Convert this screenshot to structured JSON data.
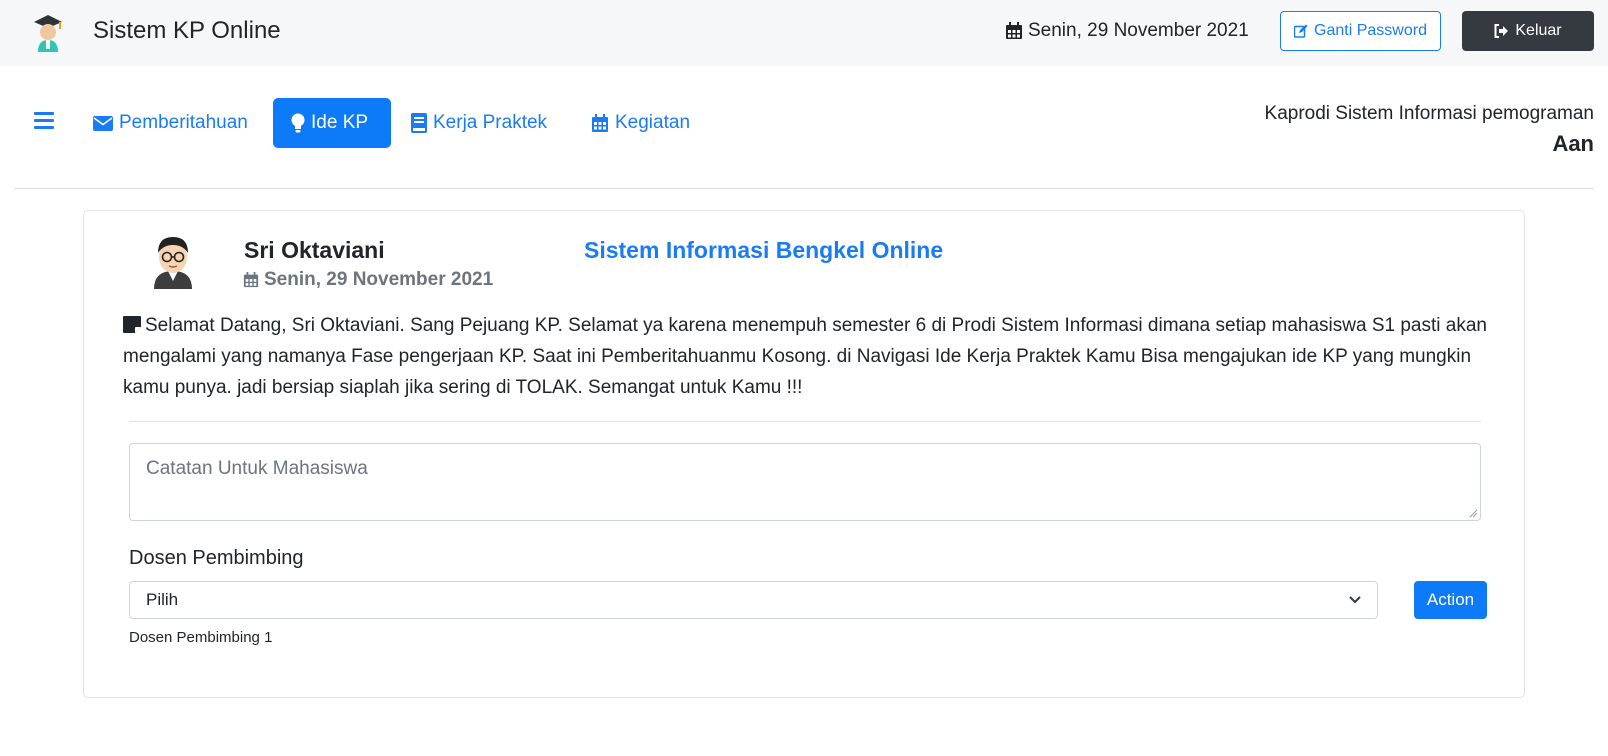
{
  "header": {
    "app_title": "Sistem KP Online",
    "date": "Senin, 29 November 2021",
    "change_password_label": "Ganti Password",
    "logout_label": "Keluar",
    "logo_icon": "graduate-icon"
  },
  "nav": {
    "items": [
      {
        "label": "Pemberitahuan",
        "icon": "envelope-icon",
        "active": false
      },
      {
        "label": "Ide KP",
        "icon": "lightbulb-icon",
        "active": true
      },
      {
        "label": "Kerja Praktek",
        "icon": "book-icon",
        "active": false
      },
      {
        "label": "Kegiatan",
        "icon": "calendar-icon",
        "active": false
      }
    ],
    "menu_icon": "hamburger-icon"
  },
  "user": {
    "role": "Kaprodi Sistem Informasi pemograman",
    "name": "Aan"
  },
  "card": {
    "student_name": "Sri Oktaviani",
    "date": "Senin, 29 November 2021",
    "project_title": "Sistem Informasi Bengkel Online",
    "message": "Selamat Datang, Sri Oktaviani. Sang Pejuang KP. Selamat ya karena menempuh semester 6 di Prodi Sistem Informasi dimana setiap mahasiswa S1 pasti akan mengalami yang namanya Fase pengerjaan KP. Saat ini Pemberitahuanmu Kosong. di Navigasi Ide Kerja Praktek Kamu Bisa mengajukan ide KP yang mungkin kamu punya. jadi bersiap siaplah jika sering di TOLAK. Semangat untuk Kamu !!!",
    "note_placeholder": "Catatan Untuk Mahasiswa",
    "supervisor_label": "Dosen Pembimbing",
    "supervisor_selected": "Pilih",
    "action_label": "Action",
    "supervisor_help": "Dosen Pembimbing 1"
  },
  "colors": {
    "primary": "#0d7bf7",
    "dark": "#343a40",
    "navbar_bg": "#f6f7f8"
  }
}
